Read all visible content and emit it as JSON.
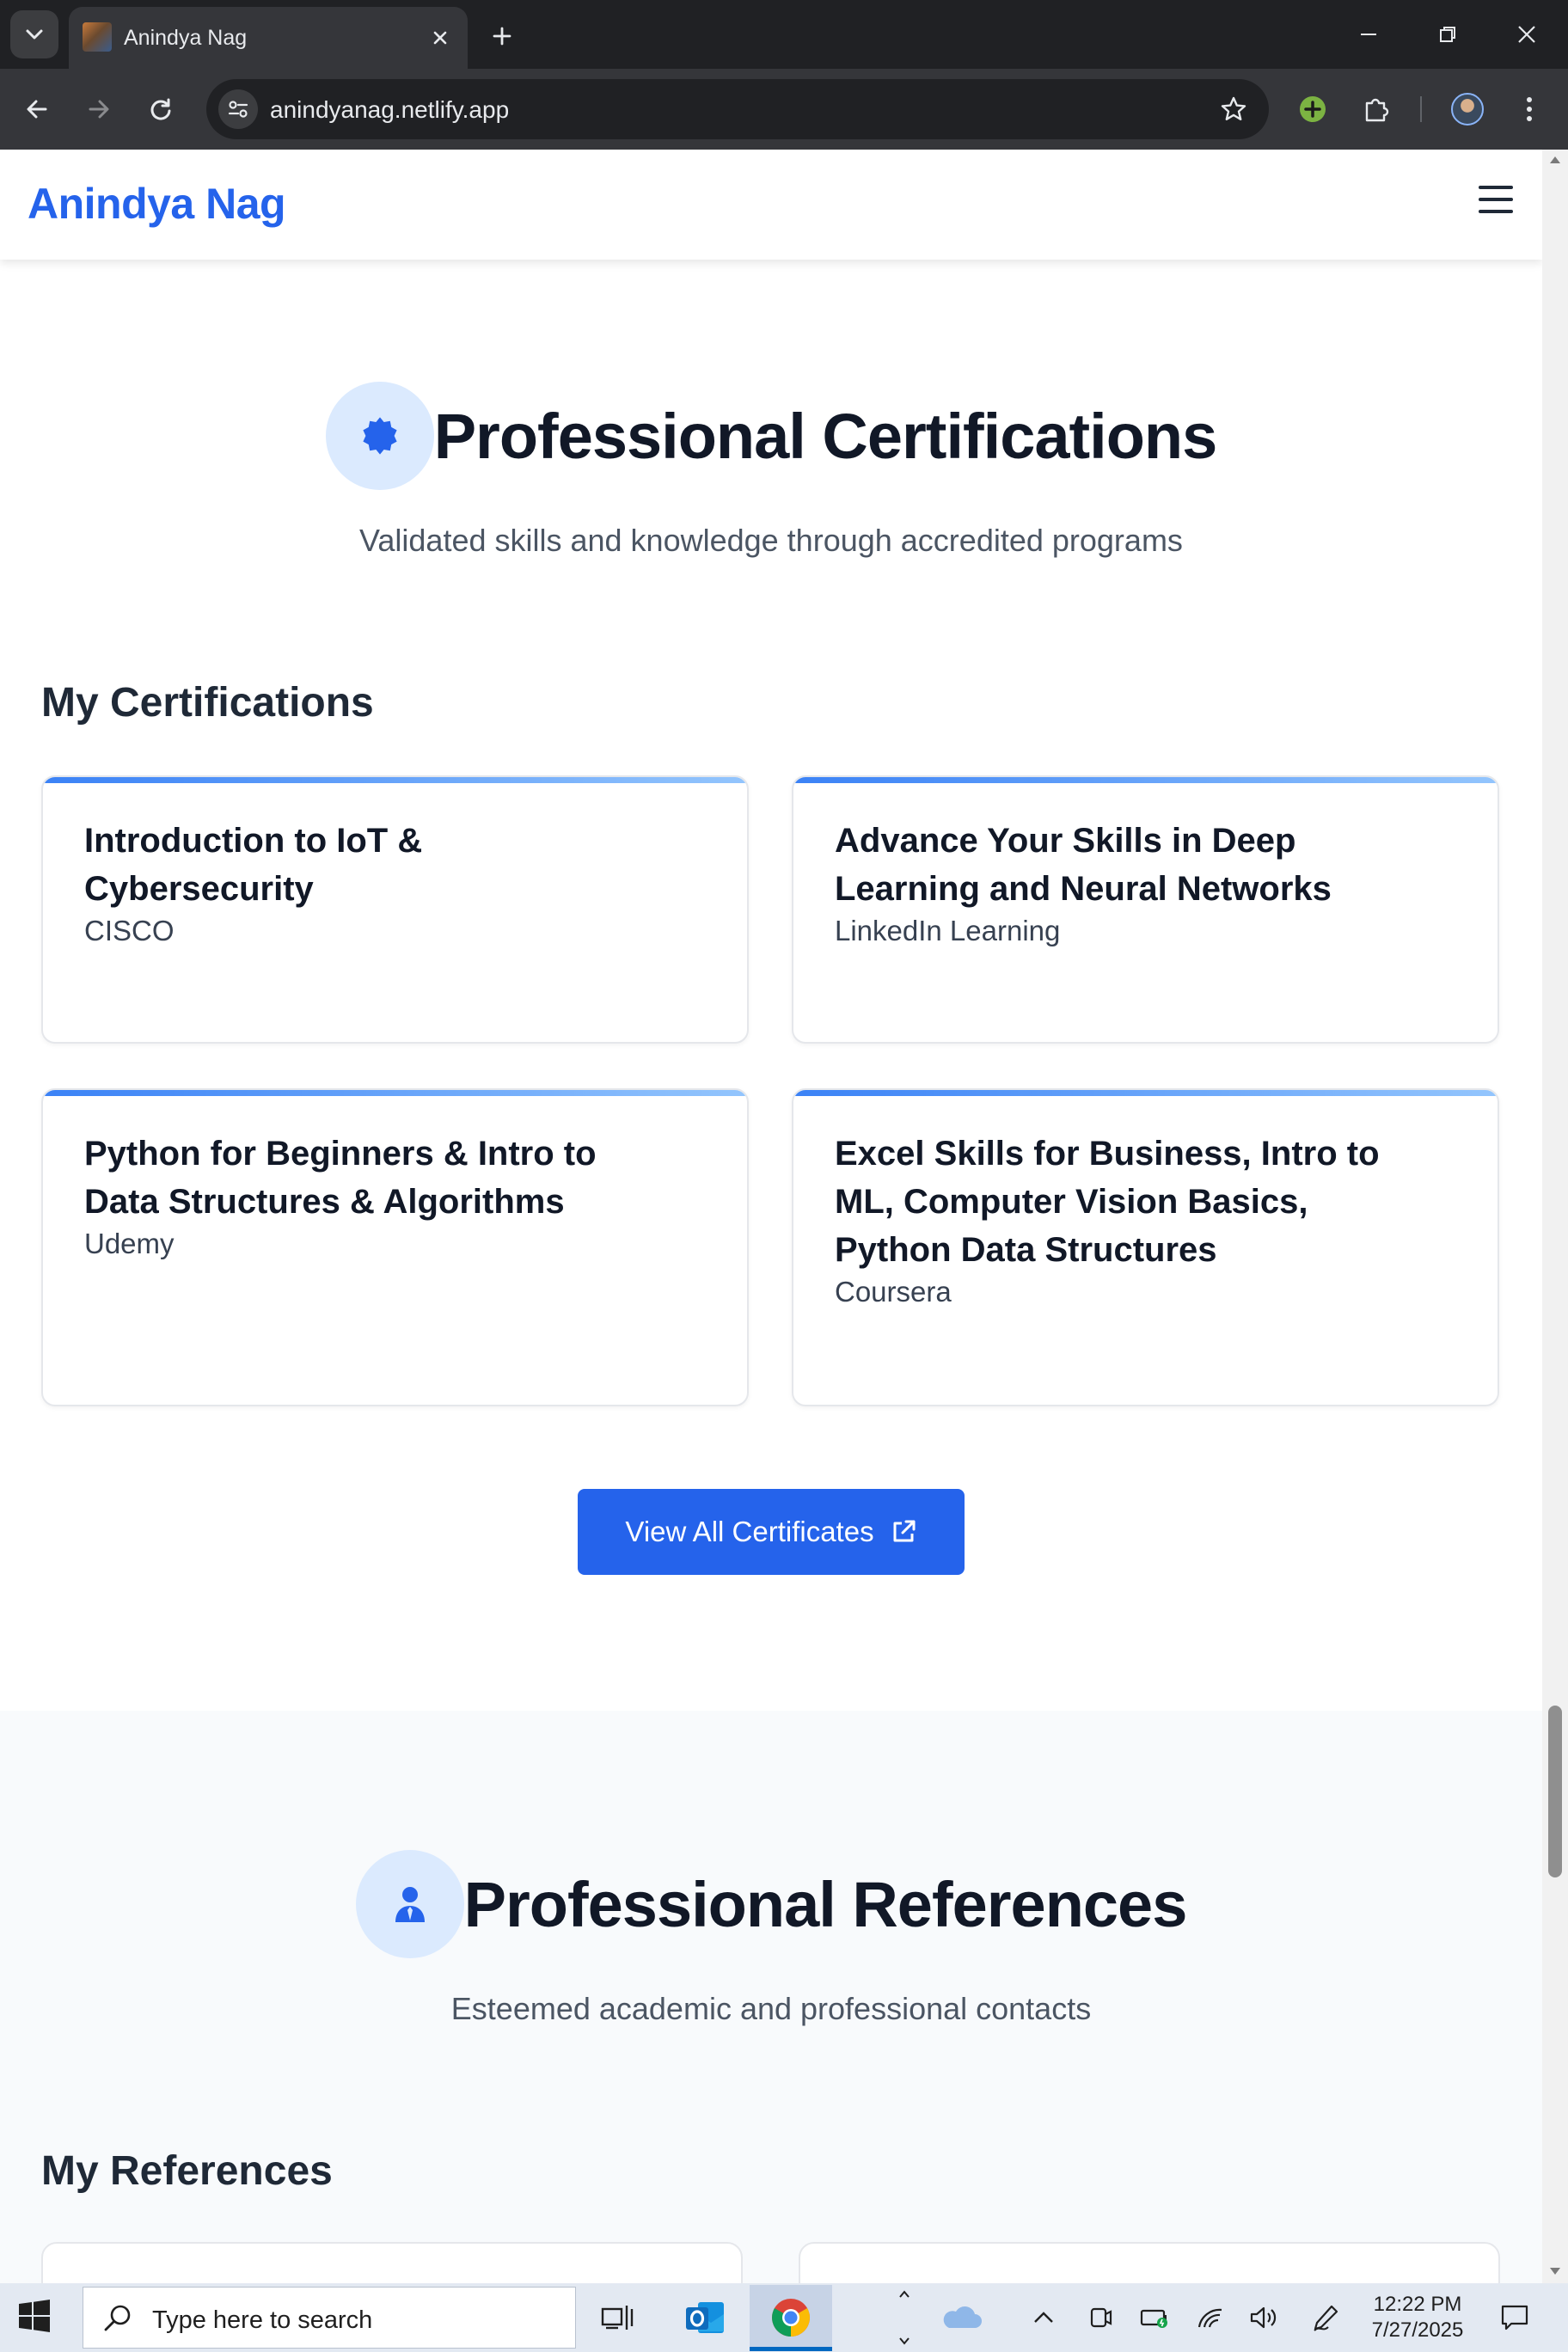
{
  "browser": {
    "tab_title": "Anindya Nag",
    "url": "anindyanag.netlify.app"
  },
  "site": {
    "brand": "Anindya Nag"
  },
  "certifications": {
    "title": "Professional Certifications",
    "subtitle": "Validated skills and knowledge through accredited programs",
    "heading": "My Certifications",
    "items": [
      {
        "title": "Introduction to IoT & Cybersecurity",
        "issuer": "CISCO"
      },
      {
        "title": "Advance Your Skills in Deep Learning and Neural Networks",
        "issuer": "LinkedIn Learning"
      },
      {
        "title": "Python for Beginners & Intro to Data Structures & Algorithms",
        "issuer": "Udemy"
      },
      {
        "title": "Excel Skills for Business, Intro to ML, Computer Vision Basics, Python Data Structures",
        "issuer": "Coursera"
      }
    ],
    "button_label": "View All Certificates"
  },
  "references": {
    "title": "Professional References",
    "subtitle": "Esteemed academic and professional contacts",
    "heading": "My References"
  },
  "taskbar": {
    "search_placeholder": "Type here to search",
    "time": "12:22 PM",
    "date": "7/27/2025"
  },
  "icons": {
    "certificate": "badge-icon",
    "references": "user-tie-icon",
    "external": "external-link-icon"
  },
  "colors": {
    "accent": "#2563eb",
    "icon_circle": "#dbeafe",
    "card_accent_start": "#3b82f6",
    "card_accent_end": "#93c5fd",
    "alt_section_bg": "#f8fafc"
  }
}
